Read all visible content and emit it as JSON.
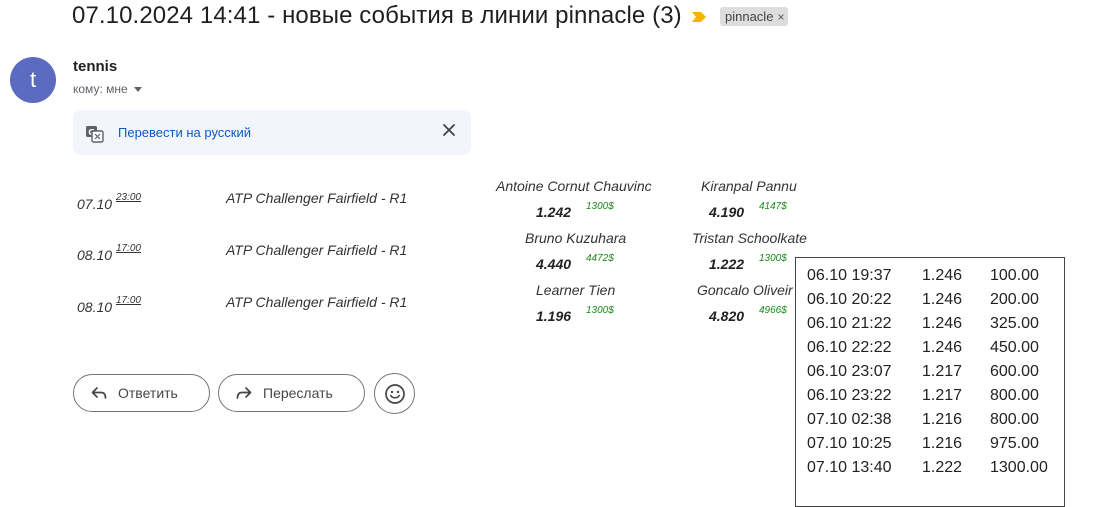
{
  "header": {
    "subject": "07.10.2024 14:41 - новые события в линии pinnacle (3)",
    "label": "pinnacle",
    "label_close": "×",
    "importance_icon": "importance-marker-icon",
    "importance_color": "#f4b400"
  },
  "sender": {
    "avatar_letter": "t",
    "avatar_color": "#5c6bc0",
    "name": "tennis",
    "recipient": "кому: мне"
  },
  "translate": {
    "link": "Перевести на русский",
    "icon": "translate-icon"
  },
  "events": [
    {
      "date": "07.10",
      "time": "23:00",
      "tournament": "ATP Challenger Fairfield - R1",
      "player1": "Antoine Cornut Chauvinc",
      "odd1": "1.242",
      "stake1": "1300$",
      "player2": "Kiranpal Pannu",
      "odd2": "4.190",
      "stake2": "4147$"
    },
    {
      "date": "08.10",
      "time": "17:00",
      "tournament": "ATP Challenger Fairfield - R1",
      "player1": "Bruno Kuzuhara",
      "odd1": "4.440",
      "stake1": "4472$",
      "player2": "Tristan Schoolkate",
      "odd2": "1.222",
      "stake2": "1300$"
    },
    {
      "date": "08.10",
      "time": "17:00",
      "tournament": "ATP Challenger Fairfield - R1",
      "player1": "Learner Tien",
      "odd1": "1.196",
      "stake1": "1300$",
      "player2": "Goncalo Oliveir",
      "odd2": "4.820",
      "stake2": "4966$"
    }
  ],
  "actions": {
    "reply": "Ответить",
    "forward": "Переслать"
  },
  "history": [
    {
      "time": "06.10 19:37",
      "odd": "1.246",
      "amount": "100.00"
    },
    {
      "time": "06.10 20:22",
      "odd": "1.246",
      "amount": "200.00"
    },
    {
      "time": "06.10 21:22",
      "odd": "1.246",
      "amount": "325.00"
    },
    {
      "time": "06.10 22:22",
      "odd": "1.246",
      "amount": "450.00"
    },
    {
      "time": "06.10 23:07",
      "odd": "1.217",
      "amount": "600.00"
    },
    {
      "time": "06.10 23:22",
      "odd": "1.217",
      "amount": "800.00"
    },
    {
      "time": "07.10 02:38",
      "odd": "1.216",
      "amount": "800.00"
    },
    {
      "time": "07.10 10:25",
      "odd": "1.216",
      "amount": "975.00"
    },
    {
      "time": "07.10 13:40",
      "odd": "1.222",
      "amount": "1300.00"
    }
  ]
}
